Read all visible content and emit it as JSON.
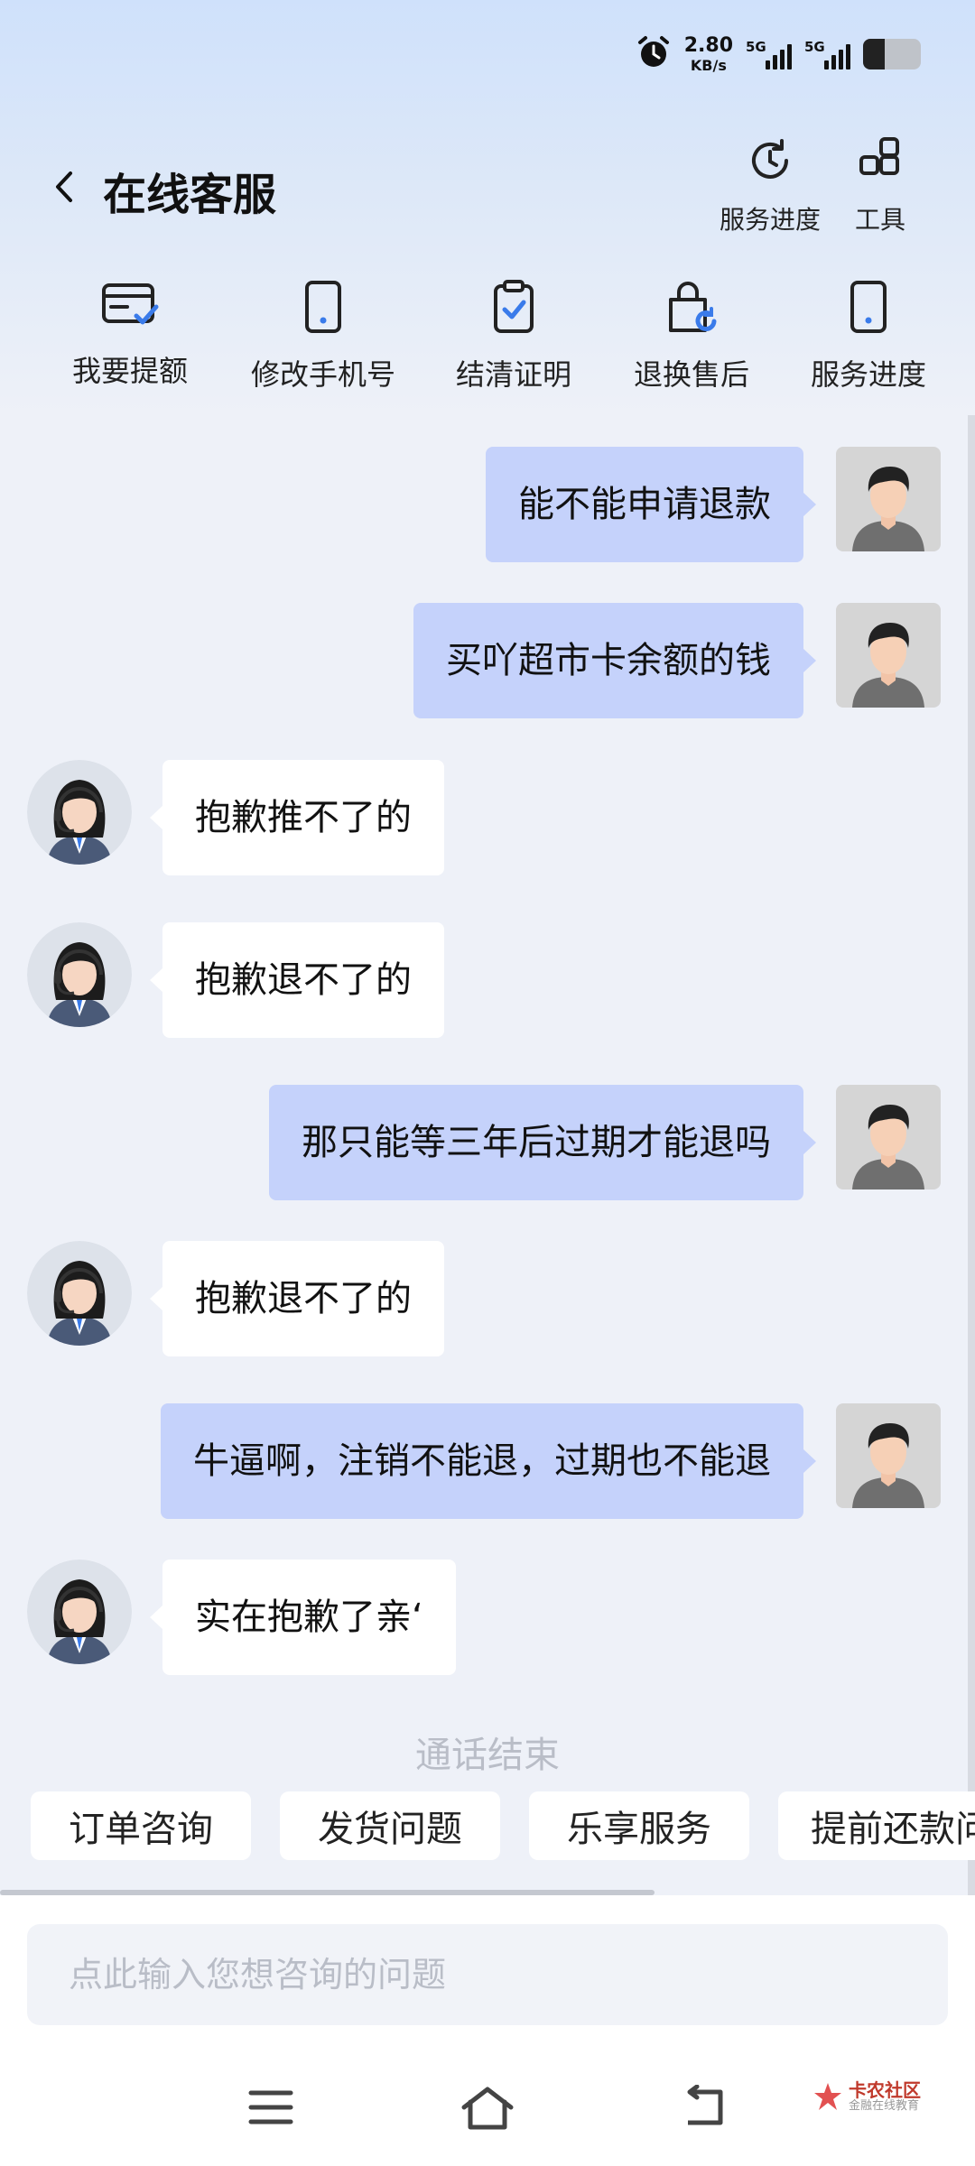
{
  "status_bar": {
    "speed_value": "2.80",
    "speed_unit": "KB/s",
    "sim1_label": "5G",
    "sim2_label": "5G",
    "battery_level": 0.38,
    "icons": [
      "alarm-icon",
      "signal-icon",
      "battery-icon"
    ]
  },
  "header": {
    "title": "在线客服",
    "back_icon": "chevron-left-icon",
    "actions": [
      {
        "label": "服务进度",
        "icon": "clock-icon"
      },
      {
        "label": "工具",
        "icon": "grid-icon"
      }
    ]
  },
  "quick_actions": [
    {
      "label": "我要提额",
      "icon": "card-icon"
    },
    {
      "label": "修改手机号",
      "icon": "phone-icon"
    },
    {
      "label": "结清证明",
      "icon": "clipboard-check-icon"
    },
    {
      "label": "退换售后",
      "icon": "bag-refresh-icon"
    },
    {
      "label": "服务进度",
      "icon": "phone-icon"
    }
  ],
  "messages": [
    {
      "sender": "user",
      "text": "能不能申请退款"
    },
    {
      "sender": "user",
      "text": "买吖超市卡余额的钱"
    },
    {
      "sender": "agent",
      "text": "抱歉推不了的"
    },
    {
      "sender": "agent",
      "text": "抱歉退不了的"
    },
    {
      "sender": "user",
      "text": "那只能等三年后过期才能退吗"
    },
    {
      "sender": "agent",
      "text": "抱歉退不了的"
    },
    {
      "sender": "user",
      "text": "牛逼啊，注销不能退，过期也不能退"
    },
    {
      "sender": "agent",
      "text": "实在抱歉了亲‘"
    }
  ],
  "call_ended": "通话结束",
  "chips": [
    "订单咨询",
    "发货问题",
    "乐享服务",
    "提前还款问"
  ],
  "input": {
    "placeholder": "点此输入您想咨询的问题",
    "value": ""
  },
  "navbar": {
    "icons": [
      "menu-icon",
      "home-icon",
      "back-icon"
    ]
  },
  "watermark": {
    "line1": "卡农社区",
    "line2": "金融在线教育"
  },
  "colors": {
    "user_bubble": "#c5d2fb",
    "agent_bubble": "#ffffff",
    "accent": "#3a7bea",
    "background": "#eef1f8"
  }
}
